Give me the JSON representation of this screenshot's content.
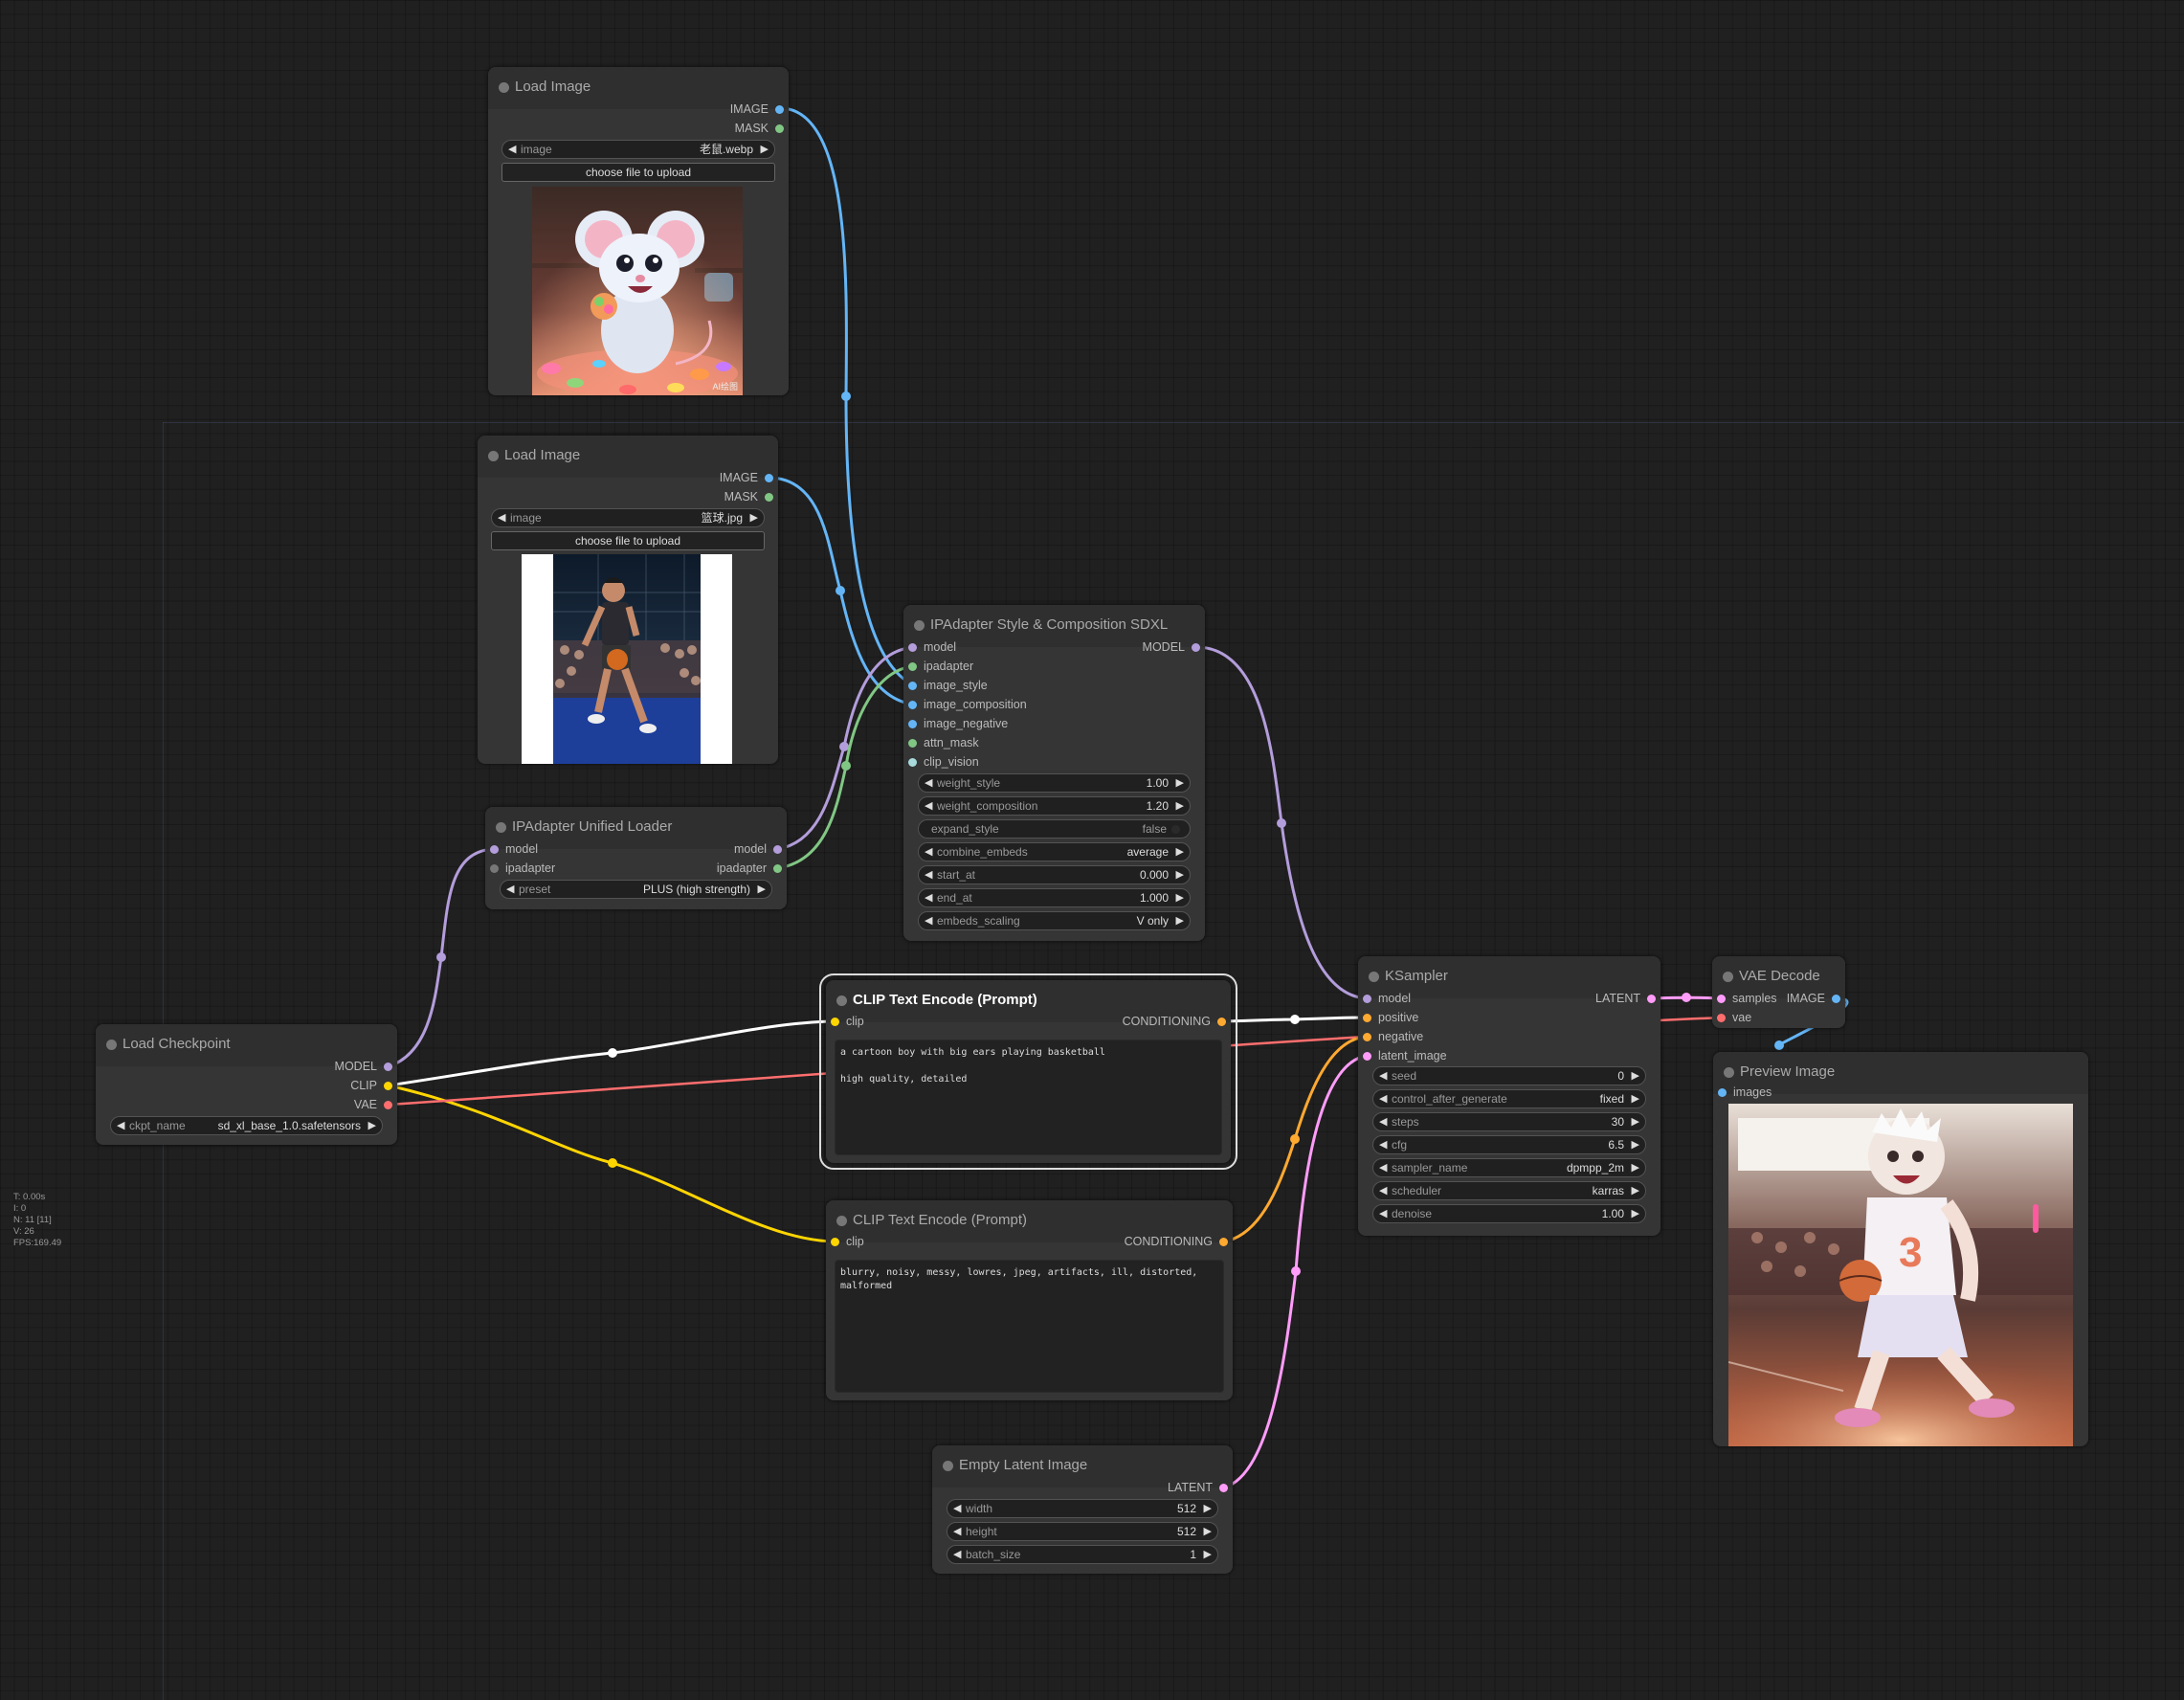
{
  "colors": {
    "model": "#b39ddb",
    "clip": "#ffd500",
    "vae": "#ff6e6e",
    "conditioning": "#ffa931",
    "latent": "#ff9cf9",
    "image": "#64b5f6",
    "mask": "#81c784",
    "ipadapter": "#81c784",
    "clip_vision": "#a8dadc"
  },
  "nodes": {
    "load_image_1": {
      "title": "Load Image",
      "outputs": [
        "IMAGE",
        "MASK"
      ],
      "image_widget": {
        "label": "image",
        "value": "老鼠.webp"
      },
      "upload_label": "choose file to upload",
      "watermark": "AI绘图"
    },
    "load_image_2": {
      "title": "Load Image",
      "outputs": [
        "IMAGE",
        "MASK"
      ],
      "image_widget": {
        "label": "image",
        "value": "篮球.jpg"
      },
      "upload_label": "choose file to upload"
    },
    "ipadapter_style": {
      "title": "IPAdapter Style & Composition SDXL",
      "inputs": [
        "model",
        "ipadapter",
        "image_style",
        "image_composition",
        "image_negative",
        "attn_mask",
        "clip_vision"
      ],
      "output": "MODEL",
      "widgets": [
        {
          "label": "weight_style",
          "value": "1.00"
        },
        {
          "label": "weight_composition",
          "value": "1.20"
        },
        {
          "label": "expand_style",
          "value": "false"
        },
        {
          "label": "combine_embeds",
          "value": "average"
        },
        {
          "label": "start_at",
          "value": "0.000"
        },
        {
          "label": "end_at",
          "value": "1.000"
        },
        {
          "label": "embeds_scaling",
          "value": "V only"
        }
      ]
    },
    "ipadapter_loader": {
      "title": "IPAdapter Unified Loader",
      "inputs": [
        "model",
        "ipadapter"
      ],
      "outputs": [
        "model",
        "ipadapter"
      ],
      "preset": {
        "label": "preset",
        "value": "PLUS (high strength)"
      }
    },
    "load_checkpoint": {
      "title": "Load Checkpoint",
      "outputs": [
        "MODEL",
        "CLIP",
        "VAE"
      ],
      "ckpt": {
        "label": "ckpt_name",
        "value": "sd_xl_base_1.0.safetensors"
      }
    },
    "clip_positive": {
      "title": "CLIP Text Encode (Prompt)",
      "input": "clip",
      "output": "CONDITIONING",
      "text": "a cartoon boy with big ears playing basketball\n\nhigh quality, detailed"
    },
    "clip_negative": {
      "title": "CLIP Text Encode (Prompt)",
      "input": "clip",
      "output": "CONDITIONING",
      "text": "blurry, noisy, messy, lowres, jpeg, artifacts, ill, distorted, malformed"
    },
    "empty_latent": {
      "title": "Empty Latent Image",
      "output": "LATENT",
      "widgets": [
        {
          "label": "width",
          "value": "512"
        },
        {
          "label": "height",
          "value": "512"
        },
        {
          "label": "batch_size",
          "value": "1"
        }
      ]
    },
    "ksampler": {
      "title": "KSampler",
      "inputs": [
        "model",
        "positive",
        "negative",
        "latent_image"
      ],
      "output": "LATENT",
      "widgets": [
        {
          "label": "seed",
          "value": "0"
        },
        {
          "label": "control_after_generate",
          "value": "fixed"
        },
        {
          "label": "steps",
          "value": "30"
        },
        {
          "label": "cfg",
          "value": "6.5"
        },
        {
          "label": "sampler_name",
          "value": "dpmpp_2m"
        },
        {
          "label": "scheduler",
          "value": "karras"
        },
        {
          "label": "denoise",
          "value": "1.00"
        }
      ]
    },
    "vae_decode": {
      "title": "VAE Decode",
      "inputs": [
        "samples",
        "vae"
      ],
      "output": "IMAGE"
    },
    "preview_image": {
      "title": "Preview Image",
      "input": "images",
      "preview_number": "3"
    }
  },
  "stats": [
    "T: 0.00s",
    "I: 0",
    "N: 11 [11]",
    "V: 26",
    "FPS:169.49"
  ]
}
